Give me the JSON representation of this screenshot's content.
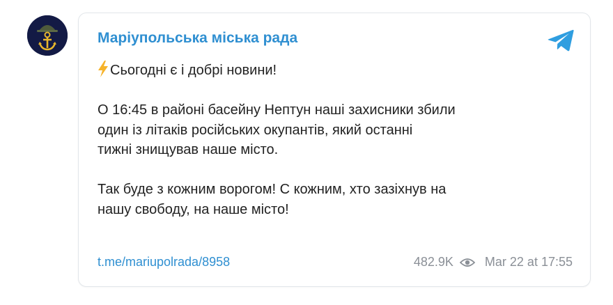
{
  "channel": {
    "avatar_icon": "anchor-helmet-icon",
    "name": "Маріупольська міська рада",
    "platform_icon": "telegram-icon",
    "accent_color": "#2f8fd1"
  },
  "message": {
    "lines": [
      "Сьогодні є і добрі новини!",
      "",
      "О 16:45 в районі басейну Нептун наші захисники збили",
      "один із літаків російських окупантів, який останні",
      "тижні знищував наше місто.",
      "",
      "Так буде з кожним ворогом! С кожним, хто зазіхнув на",
      "нашу свободу, на наше місто!"
    ],
    "lead_icon": "lightning-icon"
  },
  "footer": {
    "link": "t.me/mariupolrada/8958",
    "views": "482.9K",
    "views_icon": "eye-icon",
    "date": "Mar 22 at 17:55"
  }
}
